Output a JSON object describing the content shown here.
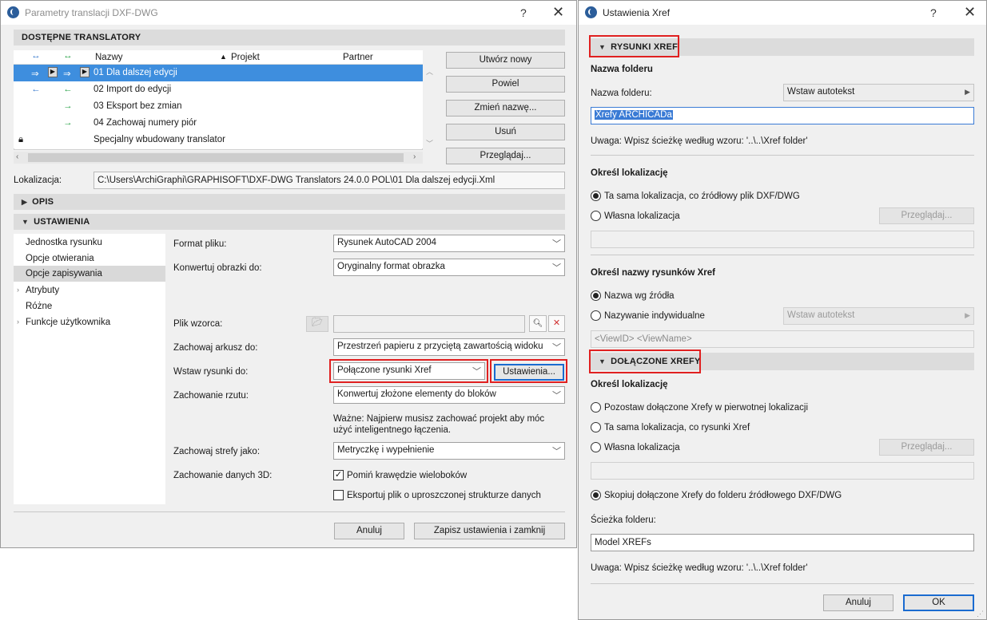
{
  "left_window": {
    "title": "Parametry translacji DXF-DWG",
    "help": "?",
    "close": "✕",
    "translators_header": "DOSTĘPNE TRANSLATORY",
    "columns": [
      "Nazwy",
      "Projekt",
      "Partner"
    ],
    "rows": [
      {
        "name": "01 Dla dalszej edycji",
        "selected": true
      },
      {
        "name": "02 Import do edycji"
      },
      {
        "name": "03 Eksport bez zmian"
      },
      {
        "name": "04 Zachowaj numery piór"
      },
      {
        "name": "Specjalny wbudowany translator"
      }
    ],
    "buttons": {
      "new": "Utwórz nowy",
      "duplicate": "Powiel",
      "rename": "Zmień nazwę...",
      "delete": "Usuń",
      "browse": "Przeglądaj..."
    },
    "location_label": "Lokalizacja:",
    "location_value": "C:\\Users\\ArchiGraphi\\GRAPHISOFT\\DXF-DWG Translators 24.0.0 POL\\01 Dla dalszej edycji.Xml",
    "sections": {
      "desc": "OPIS",
      "settings": "USTAWIENIA"
    },
    "nav": [
      "Jednostka rysunku",
      "Opcje otwierania",
      "Opcje zapisywania",
      "Atrybuty",
      "Różne",
      "Funkcje użytkownika"
    ],
    "form": {
      "file_format_label": "Format pliku:",
      "file_format_value": "Rysunek AutoCAD 2004",
      "convert_images_label": "Konwertuj obrazki do:",
      "convert_images_value": "Oryginalny format obrazka",
      "template_label": "Plik wzorca:",
      "save_sheet_label": "Zachowaj arkusz do:",
      "save_sheet_value": "Przestrzeń papieru z przyciętą zawartością widoku",
      "insert_drawings_label": "Wstaw rysunki do:",
      "insert_drawings_value": "Połączone rysunki Xref",
      "settings_button": "Ustawienia...",
      "plan_label": "Zachowanie rzutu:",
      "plan_value": "Konwertuj złożone elementy do bloków",
      "note": "Ważne: Najpierw musisz zachować projekt aby móc użyć inteligentnego łączenia.",
      "zones_label": "Zachowaj strefy jako:",
      "zones_value": "Metryczkę i wypełnienie",
      "data3d_label": "Zachowanie danych 3D:",
      "skip_edges": "Pomiń krawędzie wieloboków",
      "export_simple": "Eksportuj plik o uproszczonej strukturze danych"
    },
    "footer": {
      "cancel": "Anuluj",
      "save": "Zapisz ustawienia i zamknij"
    }
  },
  "right_window": {
    "title": "Ustawienia Xref",
    "help": "?",
    "close": "✕",
    "sec1": "RYSUNKI XREF",
    "folder_name_heading": "Nazwa folderu",
    "folder_name_label": "Nazwa folderu:",
    "insert_autotext": "Wstaw autotekst",
    "folder_name_value": "Xrefy ARCHICADa",
    "hint": "Uwaga: Wpisz ścieżkę według wzoru:   '..\\..\\Xref folder'",
    "location_heading": "Określ lokalizację",
    "loc_same": "Ta sama lokalizacja, co źródłowy plik DXF/DWG",
    "loc_own": "Własna lokalizacja",
    "browse": "Przeglądaj...",
    "names_heading": "Określ nazwy rysunków Xref",
    "name_source": "Nazwa wg źródła",
    "name_individual": "Nazywanie indywidualne",
    "name_pattern": "<ViewID> <ViewName>",
    "sec2": "DOŁĄCZONE XREFY",
    "location2_heading": "Określ lokalizację",
    "keep_original": "Pozostaw dołączone Xrefy w pierwotnej lokalizacji",
    "same_as_xref": "Ta sama lokalizacja, co rysunki Xref",
    "own2": "Własna lokalizacja",
    "copy_to_source": "Skopiuj dołączone Xrefy do folderu źródłowego DXF/DWG",
    "path_label": "Ścieżka folderu:",
    "path_value": "Model XREFs",
    "cancel": "Anuluj",
    "ok": "OK"
  }
}
